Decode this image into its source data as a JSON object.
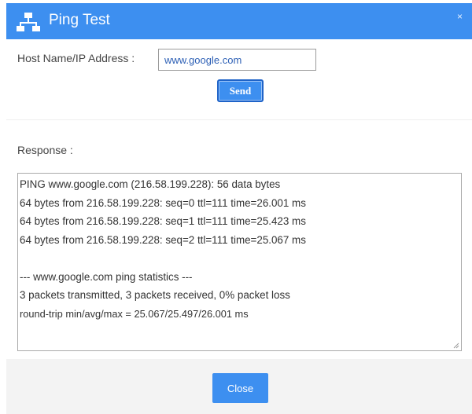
{
  "dialog": {
    "title": "Ping Test",
    "title_icon": "network-icon",
    "close_glyph": "×",
    "accent_color": "#3d8ff0"
  },
  "form": {
    "host_label": "Host Name/IP Address :",
    "host_value": "www.google.com",
    "send_label": "Send"
  },
  "response": {
    "label": "Response :",
    "lines": [
      "PING www.google.com (216.58.199.228): 56 data bytes",
      "64 bytes from 216.58.199.228: seq=0 ttl=111 time=26.001 ms",
      "64 bytes from 216.58.199.228: seq=1 ttl=111 time=25.423 ms",
      "64 bytes from 216.58.199.228: seq=2 ttl=111 time=25.067 ms",
      "",
      "--- www.google.com ping statistics ---",
      "3 packets transmitted, 3 packets received, 0% packet loss",
      "round-trip min/avg/max = 25.067/25.497/26.001 ms"
    ]
  },
  "footer": {
    "close_label": "Close"
  }
}
